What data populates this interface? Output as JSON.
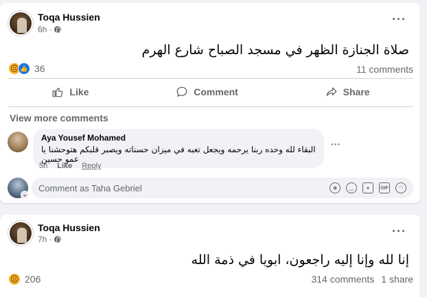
{
  "posts": [
    {
      "author": "Toqa Hussien",
      "time": "6h ·",
      "text": "صلاة الجنازة الظهر في مسجد الصباح شارع الهرم",
      "reaction_count": "36",
      "comments_count": "11 comments",
      "shares_count": "",
      "actions": {
        "like": "Like",
        "comment": "Comment",
        "share": "Share"
      },
      "view_more": "View more comments",
      "comment": {
        "author": "Aya Yousef Mohamed",
        "text": "البقاء لله وحده ربنا يرحمه ويجعل تعبه في ميزان حسناته ويصبر قلبكم هتوحشنا يا عمو حسين",
        "time": "5h",
        "like": "Like",
        "reply": "Reply"
      },
      "comment_box": {
        "placeholder": "Comment as Taha Gebriel"
      }
    },
    {
      "author": "Toqa Hussien",
      "time": "7h ·",
      "text": "إنا لله وإنا إليه راجعون، ابويا في ذمة الله",
      "reaction_count": "206",
      "comments_count": "314 comments",
      "shares_count": "1 share"
    }
  ],
  "icons": {
    "more": "more-horizontal-icon",
    "globe": "globe-icon",
    "like": "thumbs-up-icon",
    "comment": "speech-bubble-icon",
    "share": "share-arrow-icon",
    "sticker_avatar": "avatar-sticker-icon",
    "emoji": "emoji-icon",
    "camera": "camera-icon",
    "gif": "gif-icon",
    "sticker": "sticker-icon"
  },
  "colors": {
    "accent": "#1b74e4",
    "secondary_text": "#65676b",
    "divider": "#ced0d4",
    "background": "#f0f2f5"
  }
}
